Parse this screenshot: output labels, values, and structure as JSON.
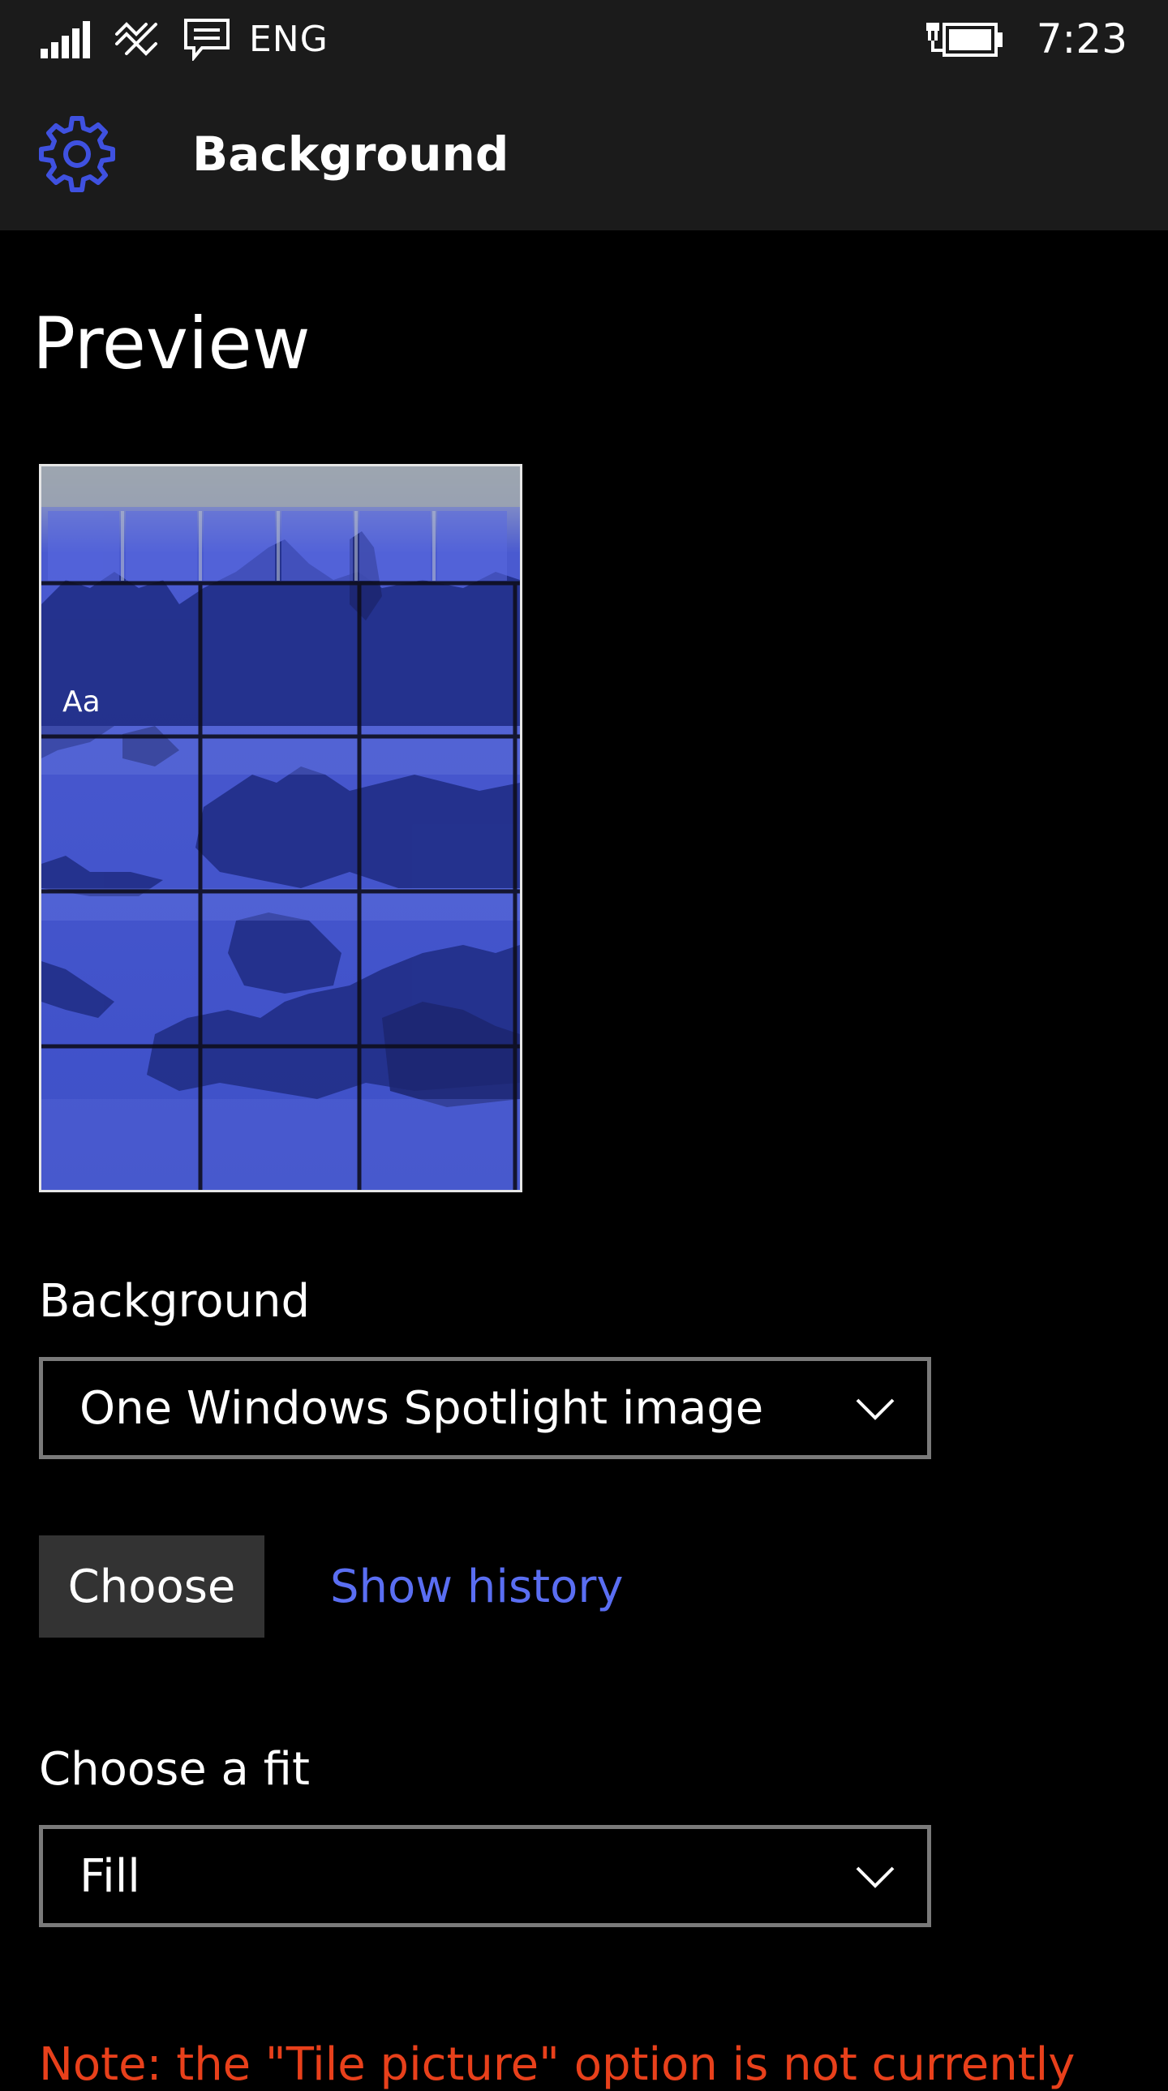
{
  "status_bar": {
    "language": "ENG",
    "time": "7:23",
    "icons": [
      "signal-icon",
      "wifi-icon",
      "message-icon",
      "battery-charging-icon"
    ]
  },
  "title_bar": {
    "icon": "gear-icon",
    "title": "Background",
    "accent_color": "#3f51e0"
  },
  "preview": {
    "heading": "Preview",
    "sample_text": "Aa",
    "tint_color": "#3a4bc8"
  },
  "background_setting": {
    "label": "Background",
    "selected": "One Windows Spotlight image"
  },
  "actions": {
    "choose_label": "Choose",
    "history_label": "Show history"
  },
  "fit_setting": {
    "label": "Choose a fit",
    "selected": "Fill"
  },
  "note": {
    "text": "Note: the \"Tile picture\" option is not currently",
    "color": "#e8401b"
  }
}
